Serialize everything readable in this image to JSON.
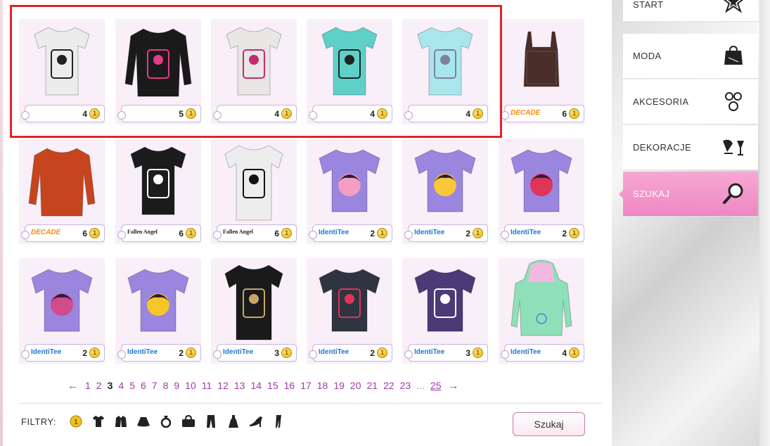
{
  "products": [
    {
      "price": "4",
      "brand": "",
      "color": "#ececec",
      "print": "#222"
    },
    {
      "price": "5",
      "brand": "",
      "color": "#1a1a1a",
      "print": "#e43b8a"
    },
    {
      "price": "4",
      "brand": "",
      "color": "#e9e6e6",
      "print": "#c42b6c"
    },
    {
      "price": "4",
      "brand": "",
      "color": "#5fd0c8",
      "print": "#222"
    },
    {
      "price": "4",
      "brand": "",
      "color": "#a8e6ec",
      "print": "#7f7f9f"
    },
    {
      "price": "6",
      "brand": "DECADE",
      "color": "#4a2e2a",
      "print": "#6b4a44"
    },
    {
      "price": "6",
      "brand": "DECADE",
      "color": "#c6451e",
      "print": "#a33312"
    },
    {
      "price": "6",
      "brand": "Fallen Angel",
      "color": "#1c1c1c",
      "print": "#ffffff"
    },
    {
      "price": "6",
      "brand": "Fallen Angel",
      "color": "#ededed",
      "print": "#111"
    },
    {
      "price": "2",
      "brand": "IdentiTee",
      "color": "#9a86df",
      "print": "#f29fc3"
    },
    {
      "price": "2",
      "brand": "IdentiTee",
      "color": "#9a86df",
      "print": "#f7c83c"
    },
    {
      "price": "2",
      "brand": "IdentiTee",
      "color": "#9a86df",
      "print": "#e0355a"
    },
    {
      "price": "2",
      "brand": "IdentiTee",
      "color": "#9a86df",
      "print": "#d04c8a"
    },
    {
      "price": "2",
      "brand": "IdentiTee",
      "color": "#9a86df",
      "print": "#f6c52a"
    },
    {
      "price": "3",
      "brand": "IdentiTee",
      "color": "#1a1a1a",
      "print": "#c9a46b"
    },
    {
      "price": "2",
      "brand": "IdentiTee",
      "color": "#2f3440",
      "print": "#e0355a"
    },
    {
      "price": "3",
      "brand": "IdentiTee",
      "color": "#4b3a77",
      "print": "#ffffff"
    },
    {
      "price": "4",
      "brand": "IdentiTee",
      "color": "#8ee0b8",
      "print": "#f4b8e0"
    }
  ],
  "pagination": {
    "prev": "←",
    "next": "→",
    "pages": [
      "1",
      "2",
      "3",
      "4",
      "5",
      "6",
      "7",
      "8",
      "9",
      "10",
      "11",
      "12",
      "13",
      "14",
      "15",
      "16",
      "17",
      "18",
      "19",
      "20",
      "21",
      "22",
      "23"
    ],
    "current": "3",
    "ellipsis": "...",
    "last": "25"
  },
  "filters": {
    "label": "FILTRY:",
    "icons": [
      "coin-icon",
      "tshirt-icon",
      "jacket-icon",
      "skirt-icon",
      "ring-icon",
      "bag-icon",
      "pants-icon",
      "dress-icon",
      "heel-icon",
      "leggings-icon"
    ]
  },
  "search_button": "Szukaj",
  "nav": [
    {
      "label": "START",
      "icon": "star-icon",
      "active": false
    },
    {
      "label": "MODA",
      "icon": "shopping-bag-icon",
      "active": false
    },
    {
      "label": "AKCESORIA",
      "icon": "accessories-icon",
      "active": false
    },
    {
      "label": "DEKORACJE",
      "icon": "decorations-icon",
      "active": false
    },
    {
      "label": "SZUKAJ",
      "icon": "magnifier-icon",
      "active": true
    }
  ]
}
